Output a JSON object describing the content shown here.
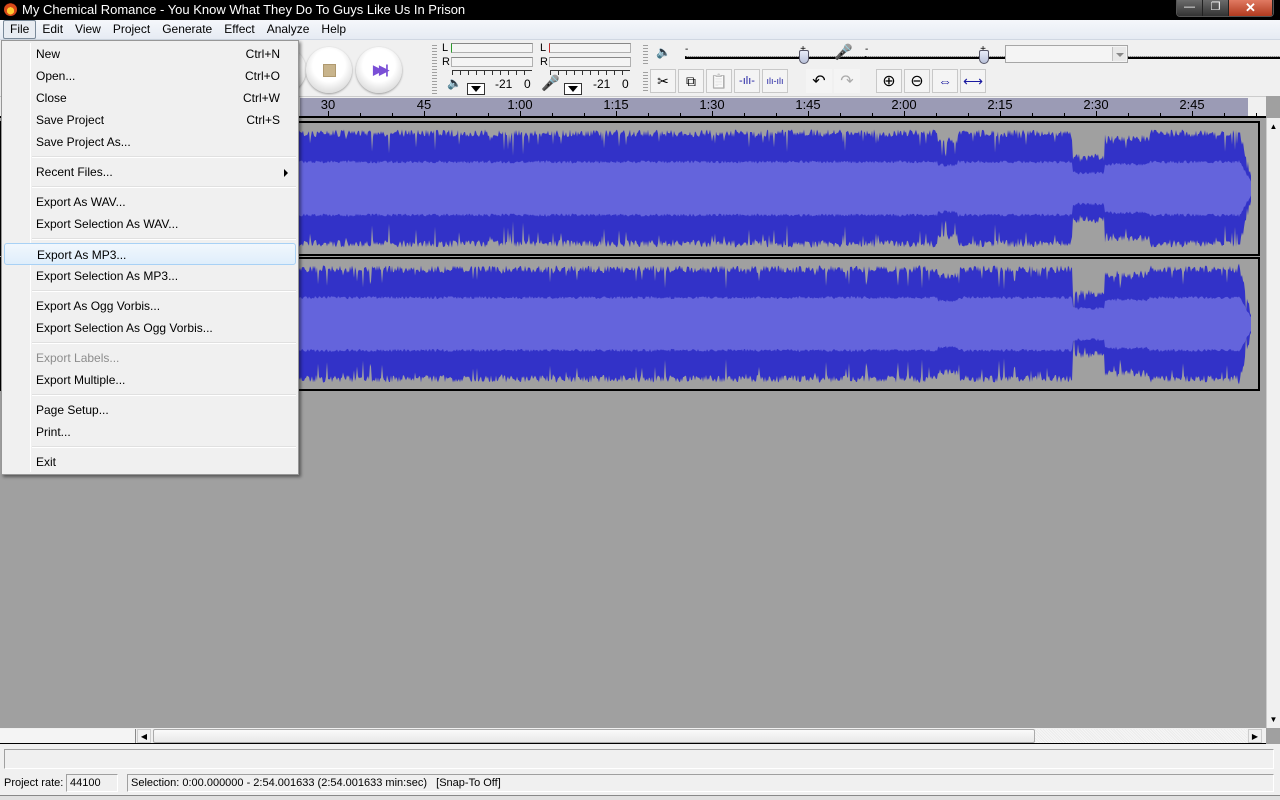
{
  "window": {
    "title": "My Chemical Romance - You Know What They Do To Guys Like Us In Prison",
    "controls": {
      "minimize": "—",
      "maximize": "❐",
      "close": "✕"
    }
  },
  "menubar": {
    "items": [
      {
        "label": "File",
        "active": true
      },
      {
        "label": "Edit"
      },
      {
        "label": "View"
      },
      {
        "label": "Project"
      },
      {
        "label": "Generate"
      },
      {
        "label": "Effect"
      },
      {
        "label": "Analyze"
      },
      {
        "label": "Help"
      }
    ]
  },
  "file_menu": {
    "items": [
      {
        "label": "New",
        "shortcut": "Ctrl+N"
      },
      {
        "label": "Open...",
        "shortcut": "Ctrl+O"
      },
      {
        "label": "Close",
        "shortcut": "Ctrl+W"
      },
      {
        "label": "Save Project",
        "shortcut": "Ctrl+S"
      },
      {
        "label": "Save Project As...",
        "shortcut": ""
      },
      {
        "separator": true
      },
      {
        "label": "Recent Files...",
        "shortcut": "",
        "submenu": true
      },
      {
        "separator": true
      },
      {
        "label": "Export As WAV...",
        "shortcut": ""
      },
      {
        "label": "Export Selection As WAV...",
        "shortcut": ""
      },
      {
        "separator": true
      },
      {
        "label": "Export As MP3...",
        "shortcut": "",
        "highlighted": true
      },
      {
        "label": "Export Selection As MP3...",
        "shortcut": ""
      },
      {
        "separator": true
      },
      {
        "label": "Export As Ogg Vorbis...",
        "shortcut": ""
      },
      {
        "label": "Export Selection As Ogg Vorbis...",
        "shortcut": ""
      },
      {
        "separator": true
      },
      {
        "label": "Export Labels...",
        "shortcut": "",
        "disabled": true
      },
      {
        "label": "Export Multiple...",
        "shortcut": ""
      },
      {
        "separator": true
      },
      {
        "label": "Page Setup...",
        "shortcut": ""
      },
      {
        "label": "Print...",
        "shortcut": ""
      },
      {
        "separator": true
      },
      {
        "label": "Exit",
        "shortcut": ""
      }
    ]
  },
  "meters": {
    "playback": {
      "channels": [
        "L",
        "R"
      ],
      "scale_labels": [
        "-21",
        "0"
      ],
      "icon": "speaker-icon"
    },
    "recording": {
      "channels": [
        "L",
        "R"
      ],
      "scale_labels": [
        "-21",
        "0"
      ],
      "icon": "microphone-icon"
    }
  },
  "mixer": {
    "output_volume": {
      "minus": "-",
      "plus": "+",
      "value_fraction": 1.0
    },
    "input_volume": {
      "minus": "-",
      "plus": "+",
      "value_fraction": 1.0
    },
    "input_source_value": ""
  },
  "edit_toolbar": {
    "buttons": [
      {
        "name": "cut-button",
        "icon": "✂"
      },
      {
        "name": "copy-button",
        "icon": "⧉"
      },
      {
        "name": "paste-button",
        "icon": "📋",
        "disabled": true
      },
      {
        "name": "trim-button",
        "icon": "-ılı-"
      },
      {
        "name": "silence-button",
        "icon": "ılı-ılı"
      },
      {
        "name": "undo-button",
        "icon": "↶"
      },
      {
        "name": "redo-button",
        "icon": "↷",
        "disabled": true
      },
      {
        "name": "zoom-in-button",
        "icon": "⊕"
      },
      {
        "name": "zoom-out-button",
        "icon": "⊖"
      },
      {
        "name": "fit-selection-button",
        "icon": "⇔"
      },
      {
        "name": "fit-project-button",
        "icon": "⟷"
      }
    ]
  },
  "ruler": {
    "labels": [
      "30",
      "45",
      "1:00",
      "1:15",
      "1:30",
      "1:45",
      "2:00",
      "2:15",
      "2:30",
      "2:45"
    ],
    "label_seconds": [
      30,
      45,
      60,
      75,
      90,
      105,
      120,
      135,
      150,
      165
    ]
  },
  "tracks": {
    "count": 2,
    "duration_seconds": 174.001633,
    "colors": {
      "waveform": "#3232c8",
      "rms": "#6464dc",
      "background": "#c0c0c0",
      "selected_background": "#a0a0a0"
    }
  },
  "status": {
    "message": "",
    "project_rate_label": "Project rate:",
    "project_rate_value": "44100",
    "selection_text": "Selection: 0:00.000000 - 2:54.001633 (2:54.001633 min:sec)   [Snap-To Off]"
  }
}
